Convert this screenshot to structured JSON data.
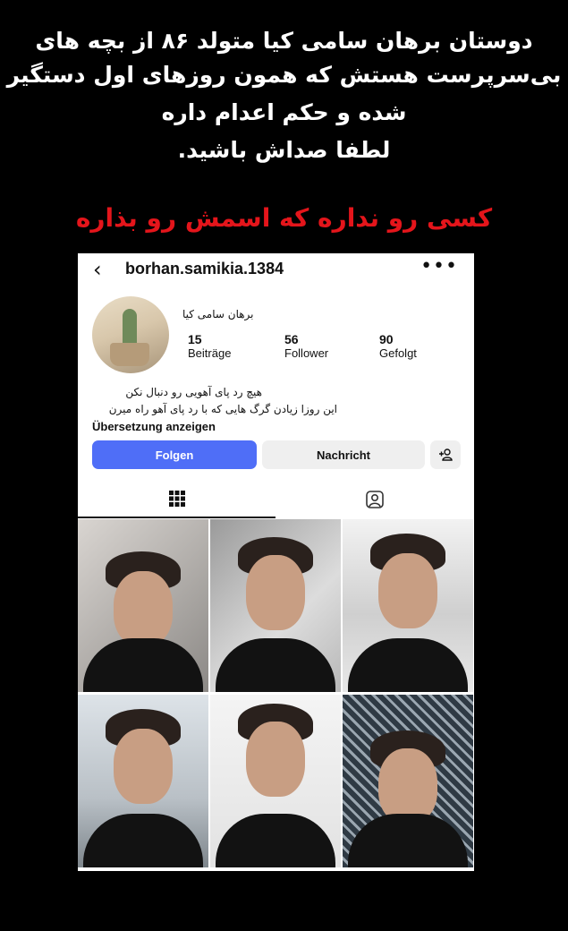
{
  "caption": {
    "line1": "دوستان برهان سامی کیا متولد ۸۶ از بچه های",
    "line2": "بی‌سرپرست هستش که همون روزهای اول دستگیر",
    "line3": "شده و حکم اعدام داره",
    "line4": "لطفا صداش باشید.",
    "highlight": "کسی رو نداره که اسمش رو بذاره"
  },
  "profile": {
    "back_icon": "chevron-left-icon",
    "username": "borhan.samikia.1384",
    "more_icon": "more-dots-icon",
    "display_name": "برهان سامی کیا",
    "stats": [
      {
        "value": "15",
        "label": "Beiträge"
      },
      {
        "value": "56",
        "label": "Follower"
      },
      {
        "value": "90",
        "label": "Gefolgt"
      }
    ],
    "bio_line1": "هیچ رد پای آهویی رو دنبال نکن",
    "bio_line2": "این روزا زیادن گرگ هایی که با رد پای آهو راه میرن",
    "translate_link": "Übersetzung anzeigen",
    "follow_button": "Folgen",
    "message_button": "Nachricht",
    "add_user_icon": "add-user-icon",
    "tabs": [
      {
        "icon": "grid-icon",
        "active": true
      },
      {
        "icon": "tagged-icon",
        "active": false
      }
    ]
  },
  "colors": {
    "background": "#000000",
    "caption_text": "#ffffff",
    "highlight_text": "#e4151b",
    "follow_button": "#4f6ef7",
    "secondary_button": "#efefef"
  },
  "gallery": {
    "posts": [
      {
        "alt": "portrait photo 1"
      },
      {
        "alt": "portrait photo 2"
      },
      {
        "alt": "portrait photo 3"
      },
      {
        "alt": "portrait photo 4"
      },
      {
        "alt": "portrait photo 5"
      },
      {
        "alt": "portrait photo 6"
      }
    ]
  }
}
